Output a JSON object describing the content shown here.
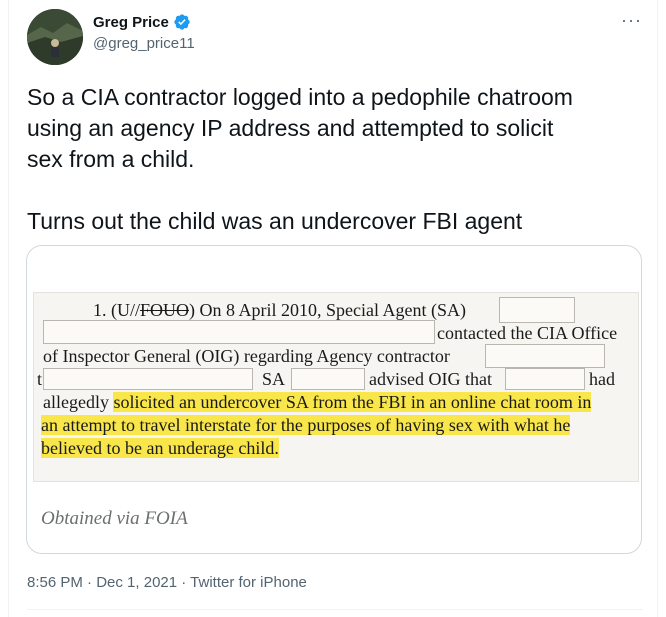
{
  "author": {
    "name": "Greg Price",
    "handle": "@greg_price11",
    "verified_icon": "verified-badge-icon",
    "accent_color": "#1d9bf0"
  },
  "more_label": "···",
  "tweet": {
    "text": "So a CIA contractor logged into a pedophile chatroom\nusing an agency IP address and attempted to solicit\nsex from a child.\n\nTurns out the child was an undercover FBI agent"
  },
  "document": {
    "line1_prefix": "1. (U//",
    "line1_strike": "FOUO",
    "line1_suffix": ")  On 8 April 2010, Special Agent (SA)",
    "line2": "contacted the CIA Office",
    "line3": "of Inspector General (OIG) regarding Agency contractor",
    "line4_a": "t",
    "line4_sa": "SA",
    "line4_advised": "advised OIG that",
    "line4_had": "had",
    "line5_plain": "allegedly ",
    "line5_hl": "solicited an undercover SA from the FBI in an online chat room in",
    "line6": "an attempt to travel interstate for the purposes of having sex with what he",
    "line7": "believed to be an underage child.",
    "highlight_color": "#f8e64a"
  },
  "caption": "Obtained via FOIA",
  "meta": {
    "time": "8:56 PM",
    "date": "Dec 1, 2021",
    "source": "Twitter for iPhone",
    "separator": " · "
  }
}
